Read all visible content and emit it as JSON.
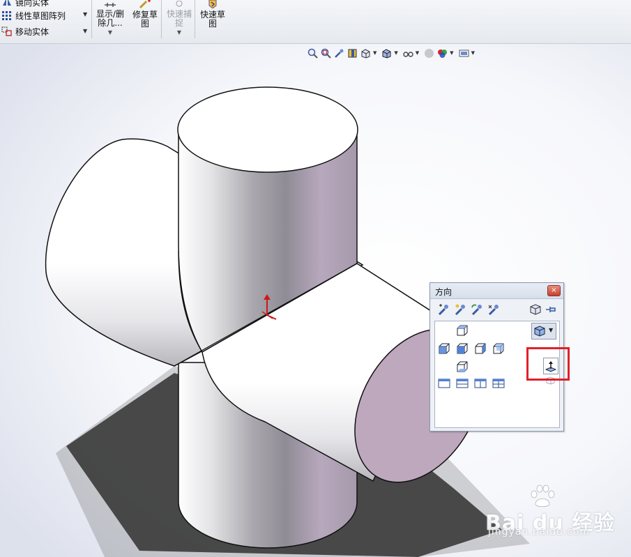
{
  "ribbon": {
    "items": [
      {
        "label": "镜向实体",
        "icon": "mirror-icon"
      },
      {
        "label": "线性草图阵列",
        "icon": "grid-pattern-icon"
      },
      {
        "label": "移动实体",
        "icon": "move-entity-icon"
      }
    ],
    "buttons": [
      {
        "label": "显示/删\n除几...",
        "icon": "display-delete-icon"
      },
      {
        "label": "修复草\n图",
        "icon": "repair-sketch-icon"
      },
      {
        "label": "快速捕\n捉",
        "icon": "quick-snap-icon"
      },
      {
        "label": "快速草\n图",
        "icon": "rapid-sketch-icon"
      }
    ]
  },
  "view_toolbar": {
    "icons": [
      "zoom-to-fit-icon",
      "zoom-area-icon",
      "previous-view-icon",
      "section-view-icon",
      "view-orientation-icon",
      "display-style-icon",
      "hide-show-icon",
      "edit-appearance-icon",
      "apply-scene-icon",
      "view-settings-icon"
    ]
  },
  "orientation_dialog": {
    "title": "方向",
    "close": "×",
    "tools": [
      "new-view-icon",
      "update-standard-views-icon",
      "reset-standard-views-icon",
      "view-selector-icon"
    ],
    "right_tools": [
      "view-cube-icon",
      "pin-icon"
    ],
    "normal_to_icon": "normal-to-icon"
  },
  "watermark": {
    "brand": "Bai du 经验",
    "url": "jingyan.baidu.com"
  },
  "colors": {
    "highlight": "#e0202a",
    "ribbon_bg": "#e6e9ee"
  }
}
